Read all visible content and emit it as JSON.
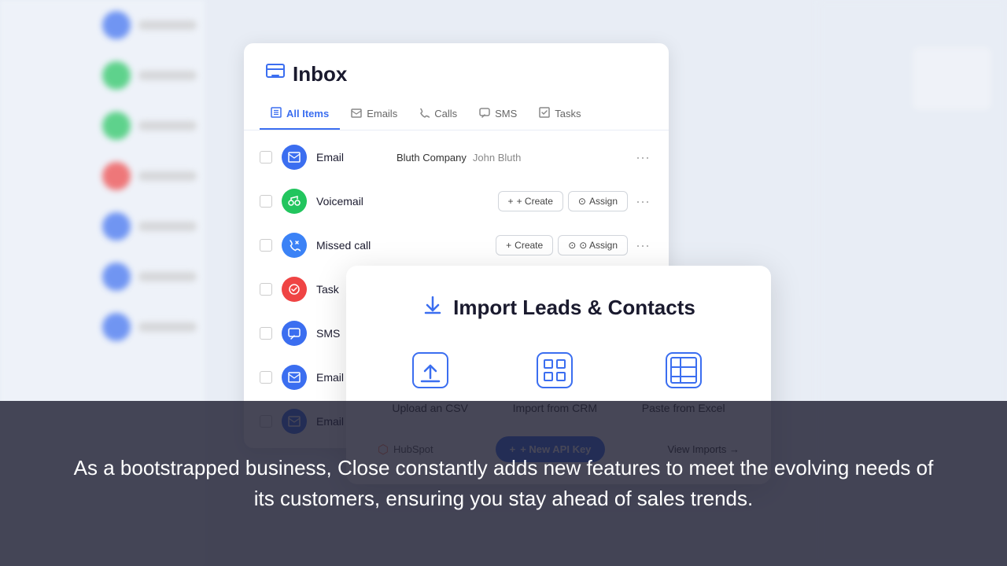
{
  "background": {
    "sidebar_items": [
      {
        "color": "#3b6ef0",
        "text_width": 80
      },
      {
        "color": "#22c55e",
        "text_width": 60
      },
      {
        "color": "#22c55e",
        "text_width": 70
      },
      {
        "color": "#ef4444",
        "text_width": 50
      },
      {
        "color": "#3b6ef0",
        "text_width": 65
      },
      {
        "color": "#3b6ef0",
        "text_width": 75
      },
      {
        "color": "#3b6ef0",
        "text_width": 55
      }
    ]
  },
  "inbox": {
    "icon": "☑",
    "title": "Inbox",
    "tabs": [
      {
        "label": "All Items",
        "icon": "☐",
        "active": true
      },
      {
        "label": "Emails",
        "icon": "✉"
      },
      {
        "label": "Calls",
        "icon": "📞"
      },
      {
        "label": "SMS",
        "icon": "💬"
      },
      {
        "label": "Tasks",
        "icon": "☑"
      }
    ],
    "items": [
      {
        "type": "Email",
        "icon_class": "icon-email",
        "icon": "✉",
        "company": "Bluth Company",
        "person": "John Bluth",
        "has_actions": false
      },
      {
        "type": "Voicemail",
        "icon_class": "icon-voicemail",
        "icon": "🎵",
        "company": "",
        "person": "",
        "has_actions": true,
        "create_label": "+ Create",
        "assign_label": "⊙ Assign"
      },
      {
        "type": "Missed call",
        "icon_class": "icon-call",
        "icon": "📞",
        "company": "",
        "person": "",
        "has_actions": true,
        "create_label": "+ Create",
        "assign_label": "⊙ Assign"
      },
      {
        "type": "Task",
        "icon_class": "icon-task",
        "icon": "✓",
        "company": "",
        "person": "",
        "has_actions": false
      },
      {
        "type": "SMS",
        "icon_class": "icon-sms",
        "icon": "💬",
        "company": "",
        "person": "",
        "has_actions": false
      },
      {
        "type": "Email",
        "icon_class": "icon-email",
        "icon": "✉",
        "company": "",
        "person": "",
        "has_actions": false
      },
      {
        "type": "Email",
        "icon_class": "icon-email",
        "icon": "✉",
        "company": "",
        "person": "",
        "has_actions": false
      }
    ]
  },
  "import_modal": {
    "title": "Import Leads & Contacts",
    "options": [
      {
        "label": "Upload an CSV",
        "icon": "upload"
      },
      {
        "label": "Import from CRM",
        "icon": "grid"
      },
      {
        "label": "Paste from Excel",
        "icon": "table"
      }
    ],
    "hubspot_label": "HubSpot",
    "new_api_label": "+ New API Key",
    "view_imports_label": "View Imports →"
  },
  "overlay": {
    "text": "As a bootstrapped business, Close constantly adds new features to meet the evolving needs of its customers, ensuring you stay ahead of sales trends."
  }
}
